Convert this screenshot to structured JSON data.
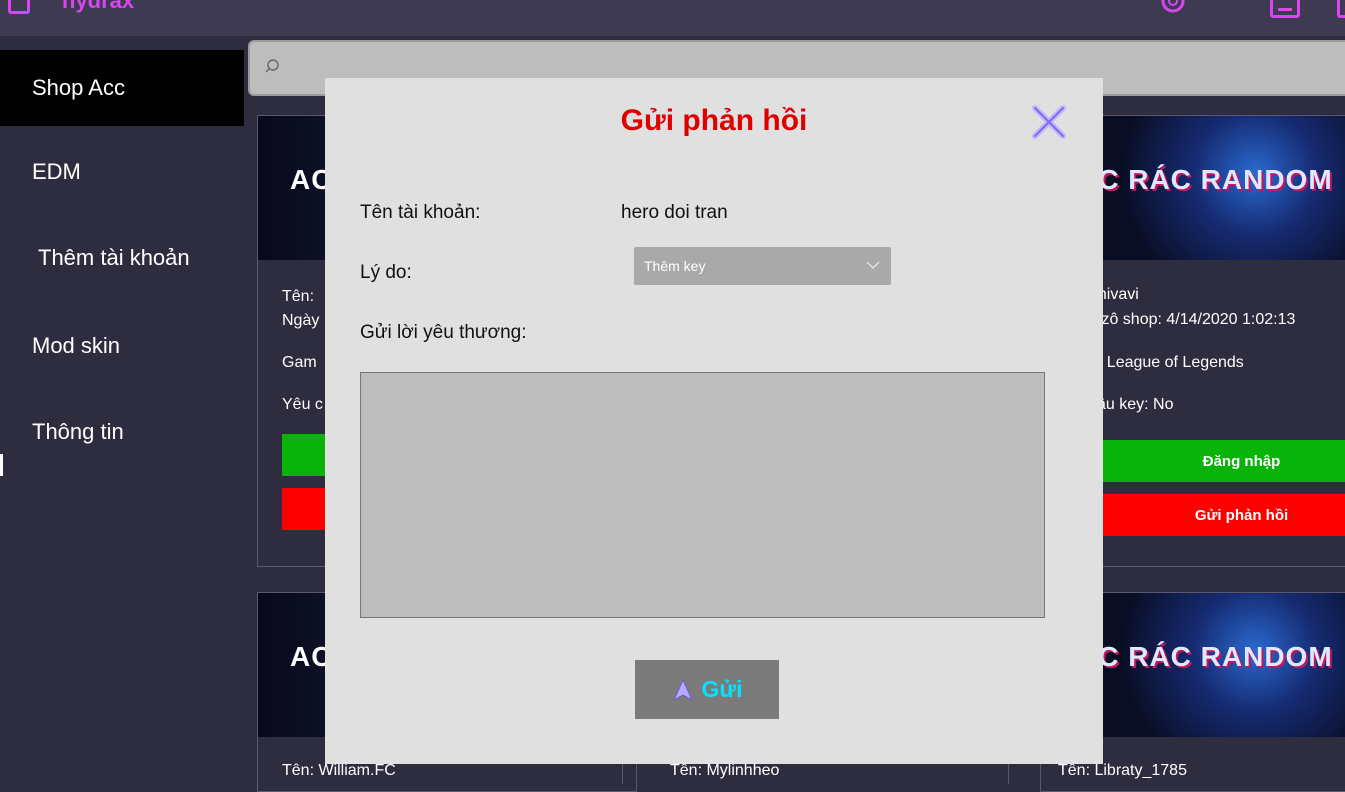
{
  "app": {
    "title": "hydrax"
  },
  "sidebar": {
    "items": [
      {
        "label": "Shop Acc"
      },
      {
        "label": "EDM"
      },
      {
        "label": "Thêm tài khoản"
      },
      {
        "label": "Mod skin"
      },
      {
        "label": "Thông tin"
      }
    ]
  },
  "search": {
    "placeholder": ""
  },
  "cards": {
    "left_top": {
      "banner_text": "AC",
      "name_prefix": "Tên: ",
      "date_prefix": "Ngày",
      "game_prefix": "Gam",
      "key_prefix": "Yêu c"
    },
    "right_top": {
      "banner_text": "CC RÁC RANDOM",
      "name": "nhivavi",
      "date": "y zô shop:  4/14/2020 1:02:13",
      "game": "e:  League of Legends",
      "key": "cầu key: No",
      "login_label": "Đăng nhập",
      "feedback_label": "Gửi phản hồi"
    },
    "left_bottom": {
      "banner_text": "AC"
    },
    "right_bottom": {
      "banner_text": "CC RÁC RANDOM"
    },
    "bottom_names": [
      "Tên: William.FC",
      "Tên: Mylinhheo",
      "Tên: Libraty_1785"
    ]
  },
  "modal": {
    "title": "Gửi phản hồi",
    "account_label": "Tên tài khoản:",
    "account_value": "hero doi tran",
    "reason_label": "Lý do:",
    "reason_selected": "Thêm key",
    "message_label": "Gửi lời yêu thương:",
    "message_value": "",
    "send_label": "Gửi"
  },
  "colors": {
    "accent": "#d946ef",
    "title_red": "#e00000",
    "send_text": "#00e5ff",
    "login_green": "#0ab30a",
    "feedback_red": "#ff0000"
  }
}
